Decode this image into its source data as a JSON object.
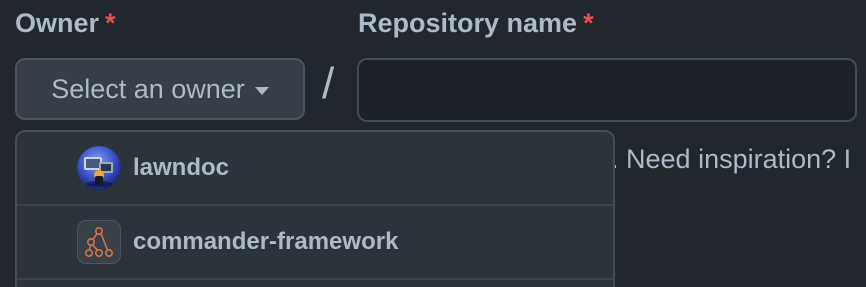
{
  "form": {
    "owner_label": "Owner",
    "repo_label": "Repository name",
    "required_marker": "*",
    "owner_button_label": "Select an owner",
    "separator": "/",
    "repo_name_value": "",
    "helper_text_fragment": "e. Need inspiration? I"
  },
  "owner_menu": {
    "items": [
      {
        "label": "lawndoc",
        "avatar_icon": "lawndoc-avatar-icon"
      },
      {
        "label": "commander-framework",
        "avatar_icon": "commander-framework-avatar-icon"
      }
    ]
  },
  "colors": {
    "background": "#22272e",
    "text": "#adbac7",
    "required": "#e5534b",
    "button_bg": "#373e47",
    "menu_bg": "#2d333b",
    "input_bg": "#1c2128",
    "avatar_accent": "#d1744a"
  }
}
